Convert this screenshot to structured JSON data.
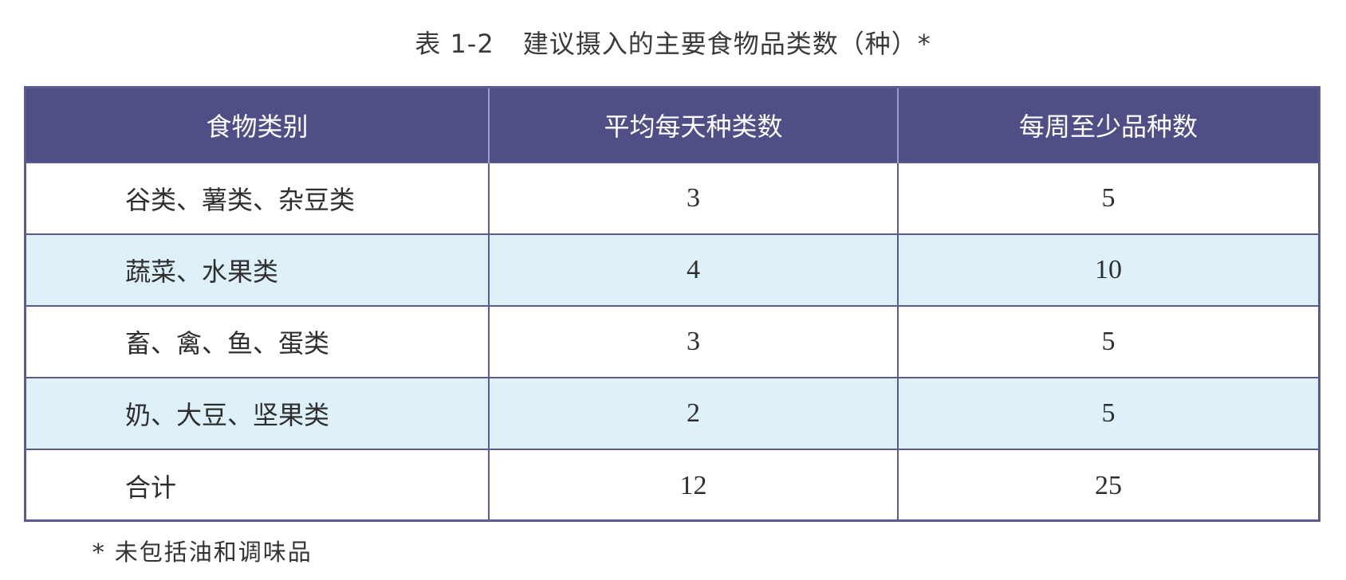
{
  "caption": {
    "number": "表 1-2",
    "title": "建议摄入的主要食物品类数（种）*"
  },
  "table": {
    "headers": [
      "食物类别",
      "平均每天种类数",
      "每周至少品种数"
    ],
    "rows": [
      [
        "谷类、薯类、杂豆类",
        "3",
        "5"
      ],
      [
        "蔬菜、水果类",
        "4",
        "10"
      ],
      [
        "畜、禽、鱼、蛋类",
        "3",
        "5"
      ],
      [
        "奶、大豆、坚果类",
        "2",
        "5"
      ],
      [
        "合计",
        "12",
        "25"
      ]
    ]
  },
  "footnote": "* 未包括油和调味品",
  "colors": {
    "header_bg": "#4f4f88",
    "border": "#5b5a91",
    "alt_row_bg": "#dff1f8"
  }
}
